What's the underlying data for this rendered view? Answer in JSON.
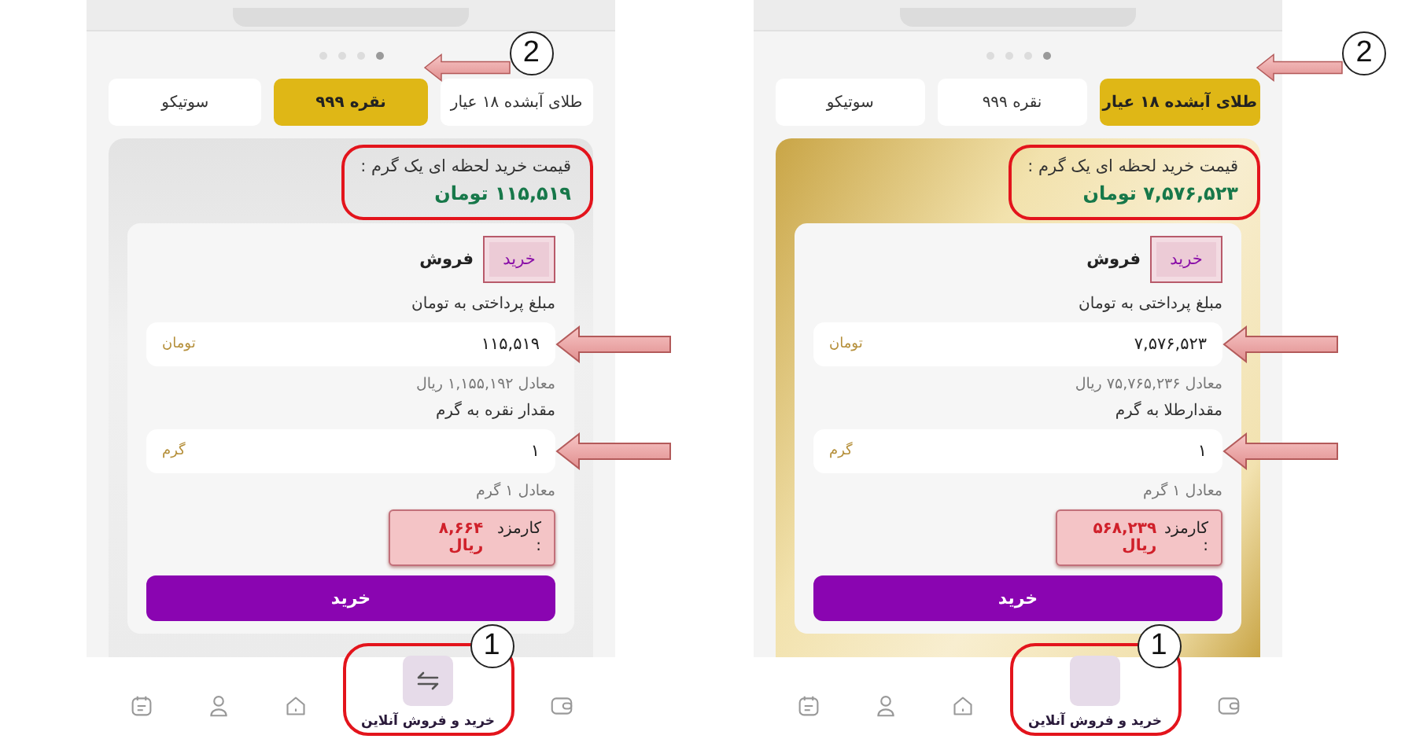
{
  "panels": [
    {
      "kind": "gold",
      "carousel_dots": [
        {
          "selected": true
        },
        {
          "selected": false
        },
        {
          "selected": false
        },
        {
          "selected": false
        }
      ],
      "tabs": [
        {
          "label": "طلای آبشده ۱۸ عیار",
          "selected": true
        },
        {
          "label": "نقره ۹۹۹",
          "selected": false
        },
        {
          "label": "سوتیکو",
          "selected": false
        }
      ],
      "tab_callout": "2",
      "price": {
        "label": "قیمت خرید لحظه ای یک گرم :",
        "value": "۷,۵۷۶,۵۲۳ تومان",
        "highlighted": true
      },
      "trade_modes": [
        {
          "label": "خرید",
          "selected": true
        },
        {
          "label": "فروش",
          "selected": false
        }
      ],
      "fields": [
        {
          "label": "مبلغ پرداختی به تومان",
          "value": "۷,۵۷۶,۵۲۳",
          "unit": "تومان",
          "hint": "معادل ۷۵,۷۶۵,۲۳۶ ریال",
          "arrow": true
        },
        {
          "label": "مقدارطلا به گرم",
          "value": "۱",
          "unit": "گرم",
          "hint": "معادل ۱ گرم",
          "arrow": true
        }
      ],
      "fee": {
        "label": "کارمزد :",
        "value": "۵۶۸,۲۳۹ ریال",
        "highlighted": true
      },
      "submit": "خرید",
      "nav": [
        {
          "kind": "wallet",
          "selected": false
        },
        {
          "kind": "trade",
          "label": "خرید و فروش آنلاین",
          "selected": true,
          "icon_shown": false
        },
        {
          "kind": "home",
          "selected": false
        },
        {
          "kind": "profile",
          "selected": false
        },
        {
          "kind": "calendar",
          "selected": false
        }
      ],
      "nav_callout": "1"
    },
    {
      "kind": "silver",
      "carousel_dots": [
        {
          "selected": true
        },
        {
          "selected": false
        },
        {
          "selected": false
        },
        {
          "selected": false
        }
      ],
      "tabs": [
        {
          "label": "طلای آبشده ۱۸ عیار",
          "selected": false
        },
        {
          "label": "نقره ۹۹۹",
          "selected": true
        },
        {
          "label": "سوتیکو",
          "selected": false
        }
      ],
      "tab_callout": "2",
      "price": {
        "label": "قیمت خرید لحظه ای یک گرم :",
        "value": "۱۱۵,۵۱۹ تومان",
        "highlighted": true
      },
      "trade_modes": [
        {
          "label": "خرید",
          "selected": true
        },
        {
          "label": "فروش",
          "selected": false
        }
      ],
      "fields": [
        {
          "label": "مبلغ پرداختی به تومان",
          "value": "۱۱۵,۵۱۹",
          "unit": "تومان",
          "hint": "معادل ۱,۱۵۵,۱۹۲ ریال",
          "arrow": true
        },
        {
          "label": "مقدار نقره به گرم",
          "value": "۱",
          "unit": "گرم",
          "hint": "معادل ۱ گرم",
          "arrow": true
        }
      ],
      "fee": {
        "label": "کارمزد :",
        "value": "۸,۶۶۴ ریال",
        "highlighted": true
      },
      "submit": "خرید",
      "nav": [
        {
          "kind": "wallet",
          "selected": false
        },
        {
          "kind": "trade",
          "label": "خرید و فروش آنلاین",
          "selected": true,
          "icon_shown": true
        },
        {
          "kind": "home",
          "selected": false
        },
        {
          "kind": "profile",
          "selected": false
        },
        {
          "kind": "calendar",
          "selected": false
        }
      ],
      "nav_callout": "1"
    }
  ]
}
